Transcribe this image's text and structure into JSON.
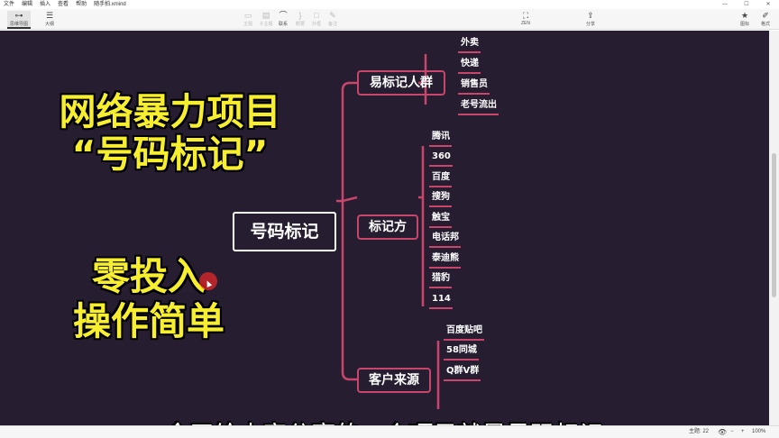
{
  "menu": [
    "文件",
    "编辑",
    "插入",
    "查看",
    "帮助",
    "随手拍.xmind"
  ],
  "window_controls": [
    "—",
    "☐",
    "✕"
  ],
  "toolbar": {
    "outline_view": "思维导图",
    "outline": "大纲",
    "topic": "主题",
    "subtopic": "子主题",
    "relationship": "联系",
    "summary": "概要",
    "boundary": "外框",
    "notes": "备注",
    "zen": "ZEN",
    "share": "分享",
    "icons": "图标",
    "format": "格式"
  },
  "overlay": {
    "title_line1": "网络暴力项目",
    "title_line2": "“号码标记”",
    "slogan_line1": "零投入",
    "slogan_line2": "操作简单",
    "subtitle": "今天给大家分享的一个项目就是号码标记"
  },
  "mindmap": {
    "root": "号码标记",
    "branch1": {
      "label": "易标记人群",
      "leaves": [
        "外卖",
        "快递",
        "销售员",
        "老号流出"
      ]
    },
    "branch2": {
      "label": "标记方",
      "leaves": [
        "腾讯",
        "360",
        "百度",
        "搜狗",
        "触宝",
        "电话邦",
        "泰迪熊",
        "猎豹",
        "114"
      ]
    },
    "branch3": {
      "label": "客户来源",
      "leaves": [
        "百度贴吧",
        "58同城",
        "Q群V群"
      ]
    }
  },
  "status": {
    "topics": "主题: 22",
    "zoom": "100%"
  },
  "colors": {
    "canvas": "#271d31",
    "branch": "#c8466c",
    "highlight": "#f6ee2e"
  }
}
